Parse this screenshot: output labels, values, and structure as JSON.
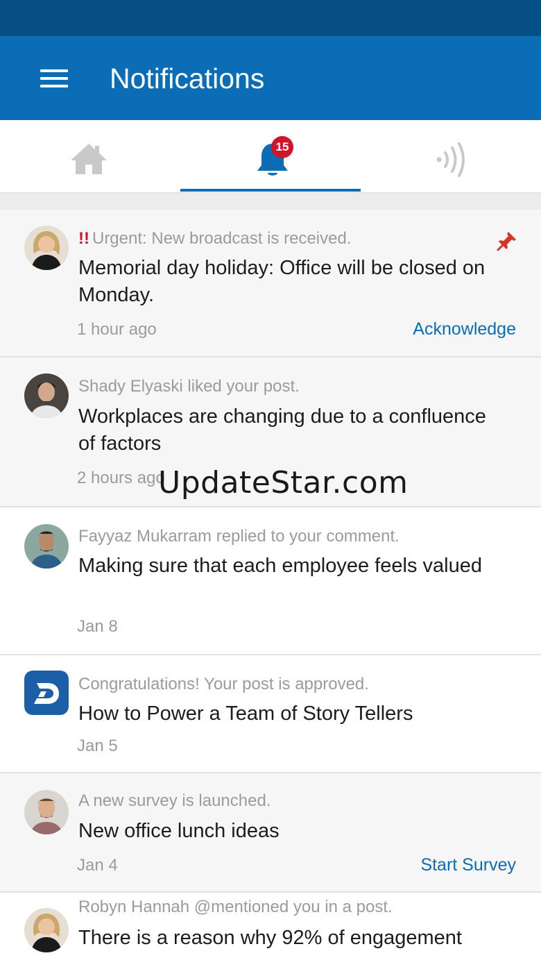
{
  "header": {
    "title": "Notifications"
  },
  "tabs": [
    {
      "name": "home",
      "icon": "home-icon",
      "active": false
    },
    {
      "name": "notifications",
      "icon": "bell-icon",
      "active": true,
      "badge": "15"
    },
    {
      "name": "broadcast",
      "icon": "broadcast-icon",
      "active": false
    }
  ],
  "colors": {
    "primary": "#0a6db5",
    "status_bar": "#064f85",
    "badge": "#d0142a",
    "urgent": "#d0142a"
  },
  "notifications": [
    {
      "meta": "Urgent: New broadcast is received.",
      "urgent_mark": "!!",
      "title": "Memorial day holiday: Office will be closed on Monday.",
      "time": "1 hour ago",
      "action": "Acknowledge",
      "pinned": true
    },
    {
      "meta": "Shady Elyaski liked your post.",
      "title": "Workplaces are changing due to a confluence of factors",
      "time": "2 hours ago"
    },
    {
      "meta": "Fayyaz Mukarram replied to your comment.",
      "title": "Making sure that each employee feels valued",
      "time": "Jan 8"
    },
    {
      "meta": "Congratulations! Your post is approved.",
      "title": "How to Power a Team of Story Tellers",
      "time": "Jan 5"
    },
    {
      "meta": "A new survey is launched.",
      "title": "New office lunch ideas",
      "time": "Jan 4",
      "action": "Start Survey"
    },
    {
      "meta": "Robyn Hannah @mentioned you in a post.",
      "title": "There is a reason why 92% of engagement"
    }
  ],
  "watermark": "UpdateStar.com"
}
